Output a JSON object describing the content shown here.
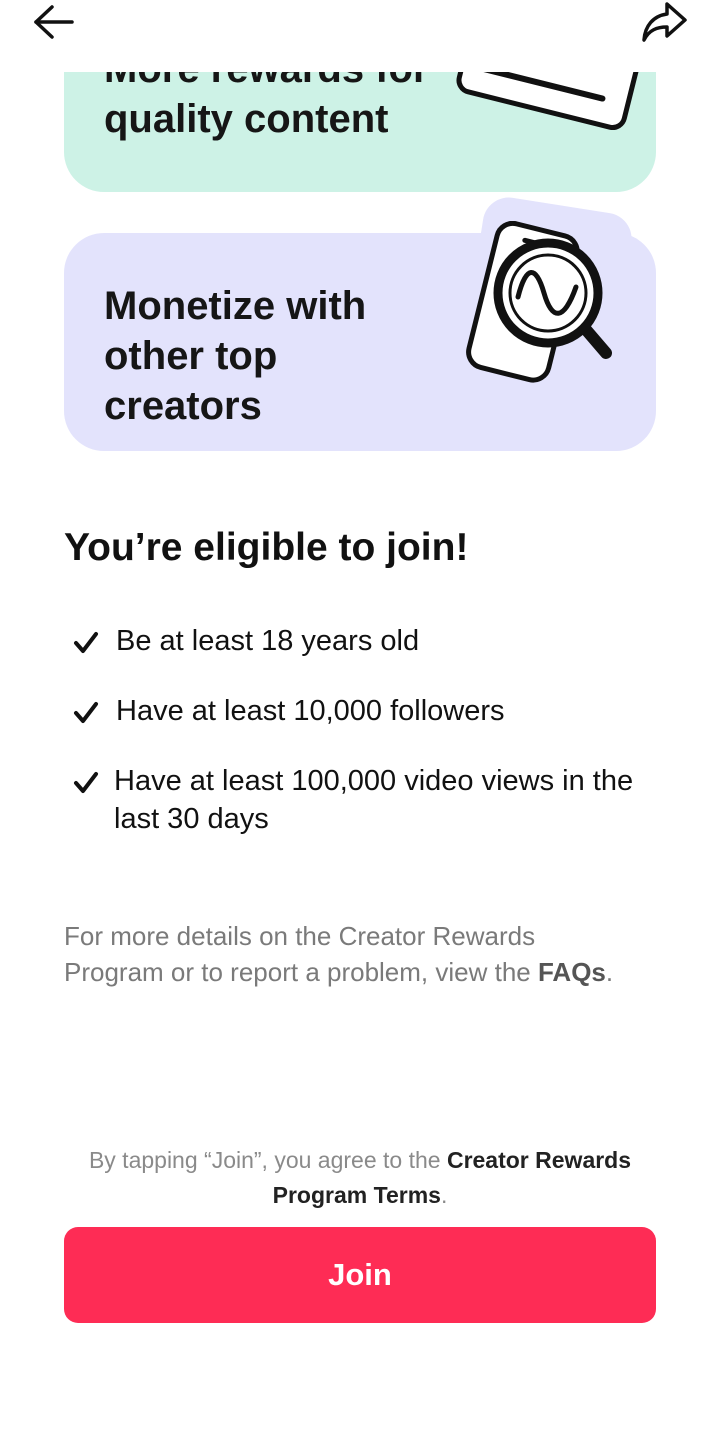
{
  "header": {
    "back_icon": "arrow-left-icon",
    "share_icon": "share-arrow-icon"
  },
  "cards": [
    {
      "title_partial_top": "More rewards for",
      "title": "quality content",
      "illustration": "video-player-icon",
      "background": "#cdf2e6"
    },
    {
      "title": "Monetize with other top creators",
      "illustration": "phone-magnifier-icon",
      "background": "#e3e3fc"
    }
  ],
  "eligibility": {
    "title": "You’re eligible to join!",
    "requirements": [
      {
        "text": "Be at least 18 years old"
      },
      {
        "text": "Have at least 10,000 followers"
      },
      {
        "text": "Have at least 100,000 video views in the last 30 days"
      }
    ]
  },
  "details": {
    "text": "For more details on the Creator Rewards Program or to report a problem, view the ",
    "link": "FAQs",
    "suffix": "."
  },
  "terms": {
    "prefix": "By tapping “Join”, you agree to the ",
    "link": "Creator Rewards Program Terms",
    "suffix": "."
  },
  "join_button": {
    "label": "Join",
    "color": "#fe2c55"
  }
}
